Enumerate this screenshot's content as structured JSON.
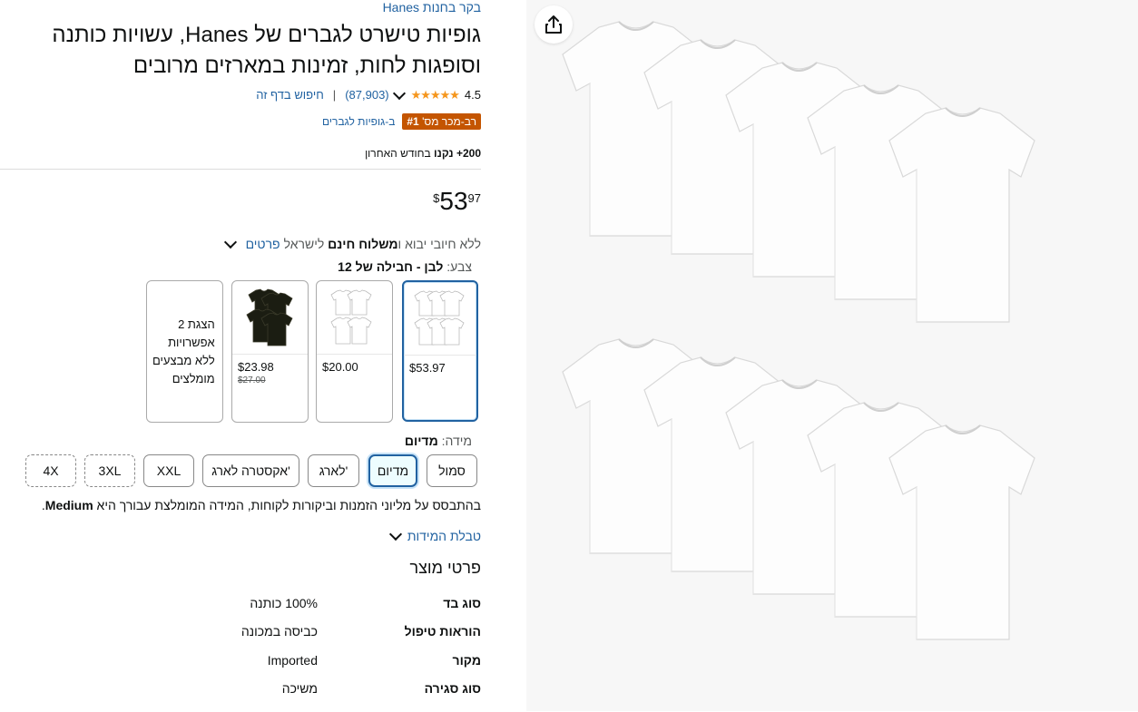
{
  "store_link": "בקר בחנות Hanes",
  "title": "גופיות טישרט לגברים של Hanes, עשויות כותנה וסופגות לחות, זמינות במארזים מרובים",
  "rating": {
    "value": "4.5",
    "count": "(87,903)",
    "search_link": "חיפוש בדף זה",
    "stars": "★★★★★"
  },
  "bestseller": {
    "badge_prefix": "רב-מכר מס' ",
    "badge_rank": "#1",
    "category": "ב-גופיות לגברים"
  },
  "bought": {
    "count": "200+",
    "bold": "נקנו",
    "suffix": "בחודש האחרון"
  },
  "price": {
    "currency": "$",
    "whole": "53",
    "fraction": "97"
  },
  "shipping": {
    "prefix": "ללא חיובי יבוא ו",
    "bold": "משלוח חינם",
    "suffix": "לישראל",
    "details_link": "פרטים"
  },
  "color": {
    "label": "צבע:",
    "value": "לבן - חבילה של 12"
  },
  "swatches": [
    {
      "price": "$53.97",
      "old_price": "",
      "selected": true,
      "color": "#ffffff"
    },
    {
      "price": "$20.00",
      "old_price": "",
      "selected": false,
      "color": "#ffffff"
    },
    {
      "price": "$23.98",
      "old_price": "$27.00",
      "selected": false,
      "color": "#1b1d12"
    }
  ],
  "more_options": [
    "הצגת 2",
    "אפשרויות",
    "ללא מבצעים",
    "מומלצים"
  ],
  "size": {
    "label": "מידה:",
    "value": "מדיום"
  },
  "sizes": [
    "סמול",
    "מדיום",
    "לארג'",
    "אקסטרה לארג'",
    "XXL",
    "3XL",
    "4X"
  ],
  "size_reco": {
    "text": "בהתבסס על מליוני הזמנות וביקורות לקוחות, המידה המומלצת עבורך היא ",
    "bold": "Medium",
    "end": "."
  },
  "size_chart": "טבלת המידות",
  "details": {
    "heading": "פרטי מוצר",
    "rows": [
      {
        "key": "סוג בד",
        "value": "100% כותנה"
      },
      {
        "key": "הוראות טיפול",
        "value": "כביסה במכונה"
      },
      {
        "key": "מקור",
        "value": "Imported"
      },
      {
        "key": "סוג סגירה",
        "value": "משיכה"
      }
    ]
  },
  "icons": {
    "share": "share-icon",
    "chevron": "chevron-down-icon"
  }
}
